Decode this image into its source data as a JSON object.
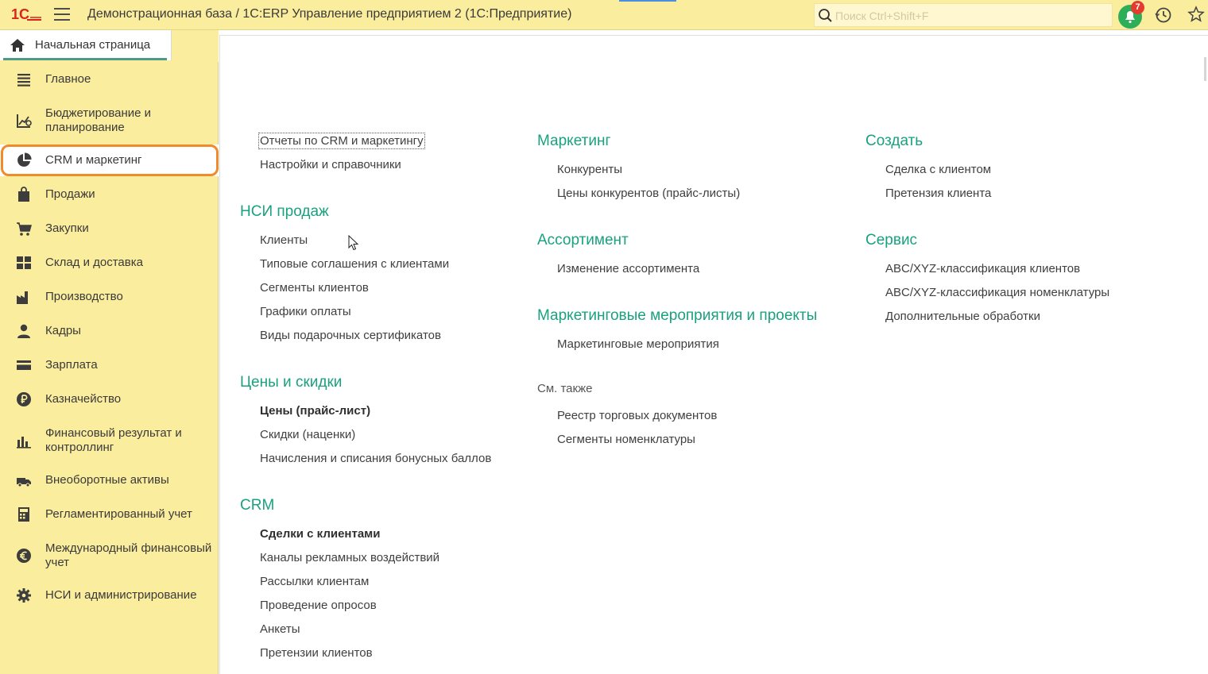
{
  "topbar": {
    "logo_text": "1С",
    "title": "Демонстрационная база / 1С:ERP Управление предприятием 2  (1С:Предприятие)",
    "search_placeholder": "Поиск Ctrl+Shift+F",
    "notifications_count": "7"
  },
  "home_tab": {
    "label": "Начальная страница"
  },
  "sidebar": {
    "items": [
      {
        "label": "Главное",
        "icon": "menu-list-icon"
      },
      {
        "label": "Бюджетирование и планирование",
        "icon": "budget-chart-icon"
      },
      {
        "label": "CRM и маркетинг",
        "icon": "pie-chart-icon"
      },
      {
        "label": "Продажи",
        "icon": "shopping-bag-icon"
      },
      {
        "label": "Закупки",
        "icon": "cart-icon"
      },
      {
        "label": "Склад и доставка",
        "icon": "warehouse-grid-icon"
      },
      {
        "label": "Производство",
        "icon": "factory-icon"
      },
      {
        "label": "Кадры",
        "icon": "person-icon"
      },
      {
        "label": "Зарплата",
        "icon": "wallet-card-icon"
      },
      {
        "label": "Казначейство",
        "icon": "ruble-coin-icon"
      },
      {
        "label": "Финансовый результат и контроллинг",
        "icon": "bar-chart-icon"
      },
      {
        "label": "Внеоборотные активы",
        "icon": "truck-icon"
      },
      {
        "label": "Регламентированный учет",
        "icon": "calculator-icon"
      },
      {
        "label": "Международный финансовый учет",
        "icon": "euro-coin-icon"
      },
      {
        "label": "НСИ и администрирование",
        "icon": "gear-icon"
      }
    ]
  },
  "content": {
    "col1": {
      "top_links": [
        "Отчеты по CRM и маркетингу",
        "Настройки и справочники"
      ],
      "sections": [
        {
          "title": "НСИ продаж",
          "links": [
            "Клиенты",
            "Типовые соглашения с клиентами",
            "Сегменты клиентов",
            "Графики оплаты",
            "Виды подарочных сертификатов"
          ]
        },
        {
          "title": "Цены и скидки",
          "links": [
            "Цены (прайс-лист)",
            "Скидки (наценки)",
            "Начисления и списания бонусных баллов"
          ]
        },
        {
          "title": "CRM",
          "links": [
            "Сделки с клиентами",
            "Каналы рекламных воздействий",
            "Рассылки клиентам",
            "Проведение опросов",
            "Анкеты",
            "Претензии клиентов"
          ]
        }
      ]
    },
    "col2": {
      "sections": [
        {
          "title": "Маркетинг",
          "links": [
            "Конкуренты",
            "Цены конкурентов (прайс-листы)"
          ]
        },
        {
          "title": "Ассортимент",
          "links": [
            "Изменение ассортимента"
          ]
        },
        {
          "title": "Маркетинговые мероприятия и проекты",
          "links": [
            "Маркетинговые мероприятия"
          ]
        }
      ],
      "see_also": {
        "label": "См. также",
        "links": [
          "Реестр торговых документов",
          "Сегменты номенклатуры"
        ]
      }
    },
    "col3": {
      "sections": [
        {
          "title": "Создать",
          "links": [
            "Сделка с клиентом",
            "Претензия клиента"
          ]
        },
        {
          "title": "Сервис",
          "links": [
            "ABC/XYZ-классификация клиентов",
            "ABC/XYZ-классификация номенклатуры",
            "Дополнительные обработки"
          ]
        }
      ]
    }
  },
  "colors": {
    "sidebar_bg": "#fbed9e",
    "section_title": "#1aa180",
    "highlight_ring": "#f08a2a",
    "badge": "#e53b2f",
    "bell": "#2fae5a"
  }
}
